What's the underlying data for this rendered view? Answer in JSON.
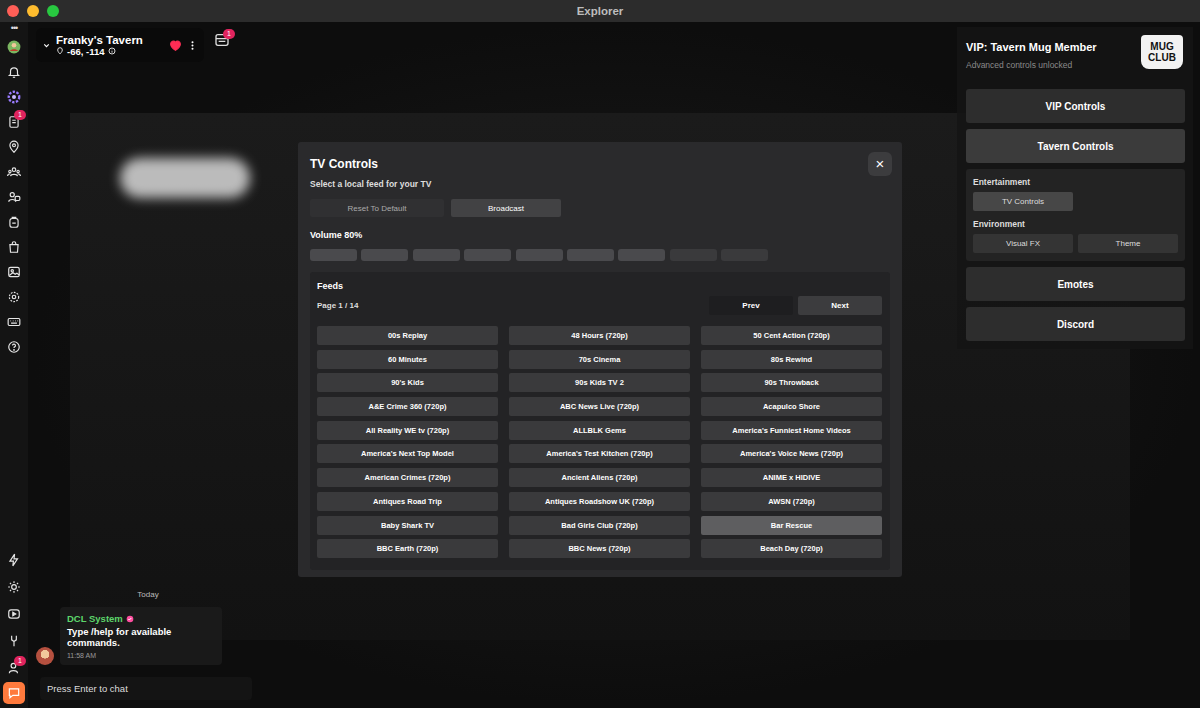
{
  "window": {
    "title": "Explorer",
    "controls": [
      {
        "name": "close",
        "color": "#ff5f57"
      },
      {
        "name": "minimize",
        "color": "#febc2e"
      },
      {
        "name": "zoom",
        "color": "#28c840"
      }
    ]
  },
  "sidebar": {
    "menu": "•••",
    "top": [
      {
        "kind": "avatar",
        "badge": "",
        "selected": false
      },
      {
        "kind": "bell",
        "badge": "",
        "selected": false
      },
      {
        "kind": "flower",
        "badge": "",
        "selected": false
      },
      {
        "kind": "doc",
        "badge": "1",
        "selected": false
      },
      {
        "kind": "pin",
        "badge": "",
        "selected": false
      },
      {
        "kind": "people",
        "badge": "",
        "selected": false
      },
      {
        "kind": "friends",
        "badge": "",
        "selected": false
      },
      {
        "kind": "backpack",
        "badge": "",
        "selected": false
      },
      {
        "kind": "bag",
        "badge": "",
        "selected": false
      },
      {
        "kind": "image",
        "badge": "",
        "selected": false
      },
      {
        "kind": "gear",
        "badge": "",
        "selected": false
      },
      {
        "kind": "keyboard",
        "badge": "",
        "selected": false
      },
      {
        "kind": "help",
        "badge": "",
        "selected": false
      }
    ],
    "bottom": [
      {
        "kind": "bolt",
        "badge": "",
        "selected": false
      },
      {
        "kind": "sun",
        "badge": "",
        "selected": false
      },
      {
        "kind": "camera",
        "badge": "",
        "selected": false
      },
      {
        "kind": "tool",
        "badge": "",
        "selected": false
      },
      {
        "kind": "person",
        "badge": "1",
        "selected": false
      },
      {
        "kind": "chat",
        "badge": "",
        "selected": true
      }
    ]
  },
  "place": {
    "name": "Franky's Tavern",
    "coords": "-66, -114",
    "favorite": true
  },
  "notifications": {
    "badge": "1"
  },
  "vip": {
    "title": "VIP: Tavern Mug Member",
    "subtitle": "Advanced controls unlocked",
    "logo": [
      "MUG",
      "CLUB"
    ],
    "menu": [
      {
        "label": "VIP Controls",
        "selected": false
      },
      {
        "label": "Tavern Controls",
        "selected": true
      }
    ],
    "groups": [
      {
        "title": "Entertainment",
        "buttons": [
          {
            "label": "TV Controls",
            "selected": true
          }
        ]
      },
      {
        "title": "Environment",
        "buttons": [
          {
            "label": "Visual FX",
            "selected": false
          },
          {
            "label": "Theme",
            "selected": false
          }
        ]
      }
    ],
    "links": [
      {
        "label": "Emotes",
        "selected": false
      },
      {
        "label": "Discord",
        "selected": false
      }
    ]
  },
  "tv": {
    "title": "TV Controls",
    "subtitle": "Select a local feed for your TV",
    "close": "×",
    "actions": [
      {
        "label": "Reset To Default",
        "selected": false
      },
      {
        "label": "Broadcast",
        "selected": true
      }
    ],
    "volume": {
      "label": "Volume 80%",
      "level": 0.8
    },
    "feeds": {
      "title": "Feeds",
      "page": "Page 1 / 14",
      "nav": [
        {
          "label": "Prev",
          "selected": false
        },
        {
          "label": "Next",
          "selected": true
        }
      ],
      "items": [
        {
          "label": "00s Replay",
          "selected": false
        },
        {
          "label": "48 Hours (720p)",
          "selected": false
        },
        {
          "label": "50 Cent Action (720p)",
          "selected": false
        },
        {
          "label": "60 Minutes",
          "selected": false
        },
        {
          "label": "70s Cinema",
          "selected": false
        },
        {
          "label": "80s Rewind",
          "selected": false
        },
        {
          "label": "90's Kids",
          "selected": false
        },
        {
          "label": "90s Kids TV 2",
          "selected": false
        },
        {
          "label": "90s Throwback",
          "selected": false
        },
        {
          "label": "A&E Crime 360 (720p)",
          "selected": false
        },
        {
          "label": "ABC News Live (720p)",
          "selected": false
        },
        {
          "label": "Acapulco Shore",
          "selected": false
        },
        {
          "label": "All Reality WE tv (720p)",
          "selected": false
        },
        {
          "label": "ALLBLK Gems",
          "selected": false
        },
        {
          "label": "America's Funniest Home Videos",
          "selected": false
        },
        {
          "label": "America's Next Top Model",
          "selected": false
        },
        {
          "label": "America's Test Kitchen (720p)",
          "selected": false
        },
        {
          "label": "America's Voice News (720p)",
          "selected": false
        },
        {
          "label": "American Crimes (720p)",
          "selected": false
        },
        {
          "label": "Ancient Aliens (720p)",
          "selected": false
        },
        {
          "label": "ANIME x HIDIVE",
          "selected": false
        },
        {
          "label": "Antiques Road Trip",
          "selected": false
        },
        {
          "label": "Antiques Roadshow UK (720p)",
          "selected": false
        },
        {
          "label": "AWSN (720p)",
          "selected": false
        },
        {
          "label": "Baby Shark TV",
          "selected": false
        },
        {
          "label": "Bad Girls Club (720p)",
          "selected": false
        },
        {
          "label": "Bar Rescue",
          "selected": true
        },
        {
          "label": "BBC Earth (720p)",
          "selected": false
        },
        {
          "label": "BBC News (720p)",
          "selected": false
        },
        {
          "label": "Beach Day (720p)",
          "selected": false
        }
      ]
    }
  },
  "chat": {
    "day": "Today",
    "messages": [
      {
        "sender": "DCL System",
        "verified": true,
        "text": "Type /help for available commands.",
        "time": "11:58 AM"
      }
    ],
    "input_placeholder": "Press Enter to chat"
  }
}
